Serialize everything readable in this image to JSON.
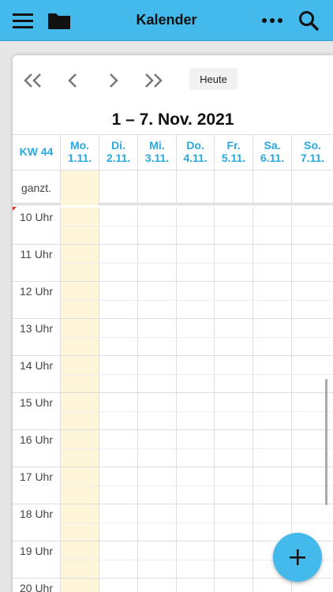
{
  "app": {
    "title": "Kalender"
  },
  "icons": {
    "menu": "hamburger-icon",
    "folder": "folder-icon",
    "more": "more-icon",
    "search": "search-icon",
    "add": "plus-icon"
  },
  "nav": {
    "today_label": "Heute"
  },
  "range_title": "1 – 7. Nov. 2021",
  "week_label": "KW 44",
  "days": [
    {
      "name": "Mo.",
      "date": "1.11."
    },
    {
      "name": "Di.",
      "date": "2.11."
    },
    {
      "name": "Mi.",
      "date": "3.11."
    },
    {
      "name": "Do.",
      "date": "4.11."
    },
    {
      "name": "Fr.",
      "date": "5.11."
    },
    {
      "name": "Sa.",
      "date": "6.11."
    },
    {
      "name": "So.",
      "date": "7.11."
    }
  ],
  "allday_label": "ganzt.",
  "hours": [
    "10 Uhr",
    "11 Uhr",
    "12 Uhr",
    "13 Uhr",
    "14 Uhr",
    "15 Uhr",
    "16 Uhr",
    "17 Uhr",
    "18 Uhr",
    "19 Uhr",
    "20 Uhr"
  ],
  "colors": {
    "accent": "#43b9ec",
    "today_column": "#fff6d9",
    "now_marker": "#e0302a"
  }
}
